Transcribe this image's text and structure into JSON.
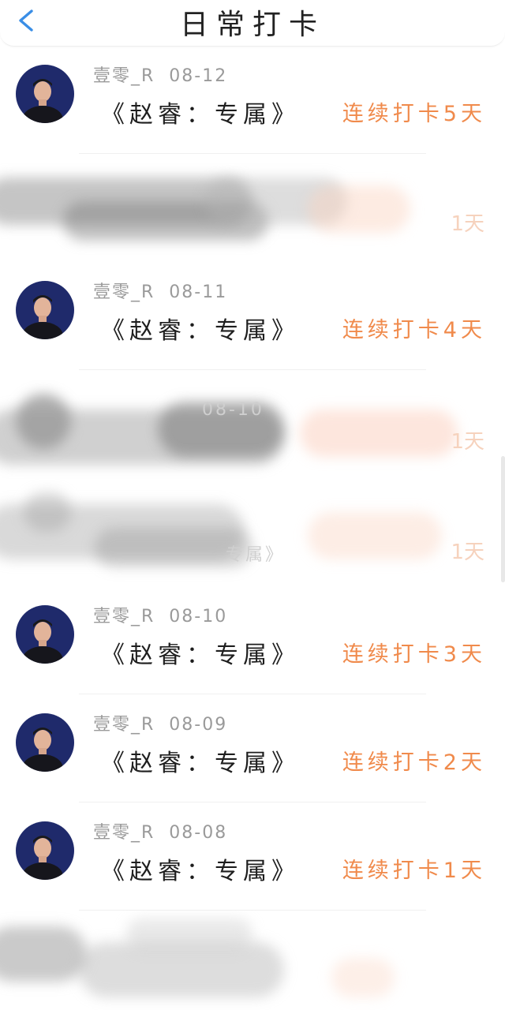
{
  "header": {
    "title": "日常打卡",
    "back_icon": "chevron-left-icon",
    "accent_color": "#3a8ee6"
  },
  "colors": {
    "streak": "#f08a4b",
    "meta": "#9a9a9a"
  },
  "entries": [
    {
      "user": "壹零_R",
      "date": "08-12",
      "book": "《赵睿：专属》",
      "streak": "连续打卡5天"
    },
    {
      "user": "壹零_R",
      "date": "08-11",
      "book": "《赵睿：专属》",
      "streak": "连续打卡4天"
    },
    {
      "user": "壹零_R",
      "date": "08-10",
      "book": "《赵睿：专属》",
      "streak": "连续打卡3天"
    },
    {
      "user": "壹零_R",
      "date": "08-09",
      "book": "《赵睿：专属》",
      "streak": "连续打卡2天"
    },
    {
      "user": "壹零_R",
      "date": "08-08",
      "book": "《赵睿：专属》",
      "streak": "连续打卡1天"
    }
  ],
  "redacted": {
    "faint_date": "08-10",
    "faint_day_a": "1天",
    "faint_book": "专属》",
    "faint_day_b": "1天"
  }
}
